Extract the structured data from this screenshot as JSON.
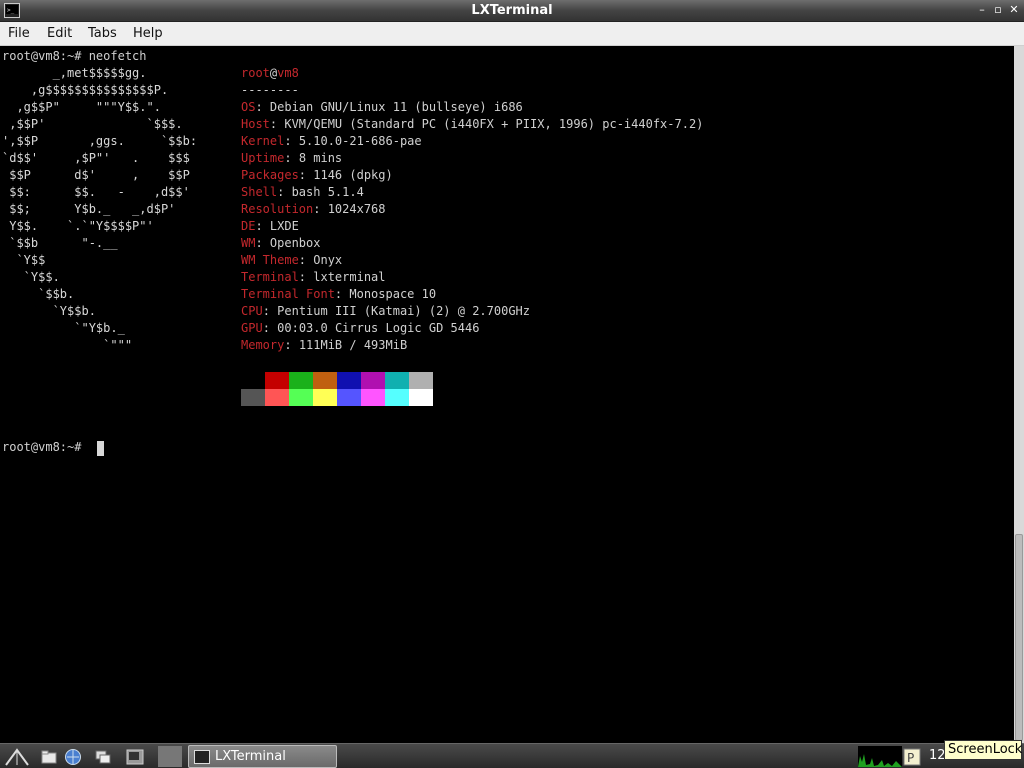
{
  "window": {
    "title": "LXTerminal",
    "controls": {
      "minimize": "–",
      "maximize": "▫",
      "close": "✕"
    }
  },
  "menu": [
    "File",
    "Edit",
    "Tabs",
    "Help"
  ],
  "terminal": {
    "command_line": "root@vm8:~# neofetch",
    "prompt": "root@vm8:~# ",
    "art": [
      "       _,met$$$$$gg.",
      "    ,g$$$$$$$$$$$$$$$P.",
      "  ,g$$P\"     \"\"\"Y$$.\".",
      " ,$$P'              `$$$.",
      "',$$P       ,ggs.     `$$b:",
      "`d$$'     ,$P\"'   .    $$$",
      " $$P      d$'     ,    $$P",
      " $$:      $$.   -    ,d$$'",
      " $$;      Y$b._   _,d$P'",
      " Y$$.    `.`\"Y$$$$P\"'",
      " `$$b      \"-.__",
      "  `Y$$",
      "   `Y$$.",
      "     `$$b.",
      "       `Y$$b.",
      "          `\"Y$b._",
      "              `\"\"\""
    ],
    "user": "root",
    "at": "@",
    "host": "vm8",
    "separator": "--------",
    "info": [
      {
        "key": "OS",
        "value": "Debian GNU/Linux 11 (bullseye) i686"
      },
      {
        "key": "Host",
        "value": "KVM/QEMU (Standard PC (i440FX + PIIX, 1996) pc-i440fx-7.2)"
      },
      {
        "key": "Kernel",
        "value": "5.10.0-21-686-pae"
      },
      {
        "key": "Uptime",
        "value": "8 mins"
      },
      {
        "key": "Packages",
        "value": "1146 (dpkg)"
      },
      {
        "key": "Shell",
        "value": "bash 5.1.4"
      },
      {
        "key": "Resolution",
        "value": "1024x768"
      },
      {
        "key": "DE",
        "value": "LXDE"
      },
      {
        "key": "WM",
        "value": "Openbox"
      },
      {
        "key": "WM Theme",
        "value": "Onyx"
      },
      {
        "key": "Terminal",
        "value": "lxterminal"
      },
      {
        "key": "Terminal Font",
        "value": "Monospace 10"
      },
      {
        "key": "CPU",
        "value": "Pentium III (Katmai) (2) @ 2.700GHz"
      },
      {
        "key": "GPU",
        "value": "00:03.0 Cirrus Logic GD 5446"
      },
      {
        "key": "Memory",
        "value": "111MiB / 493MiB"
      }
    ],
    "palette_row1": [
      "#000000",
      "#c40000",
      "#1ab11a",
      "#c06010",
      "#1010b0",
      "#b010b0",
      "#10b0b0",
      "#b0b0b0"
    ],
    "palette_row2": [
      "#555555",
      "#ff5555",
      "#55ff55",
      "#ffff55",
      "#5555ff",
      "#ff55ff",
      "#55ffff",
      "#ffffff"
    ]
  },
  "taskbar": {
    "task_label": "LXTerminal",
    "clock_partial": "12",
    "tooltip": "ScreenLock"
  }
}
